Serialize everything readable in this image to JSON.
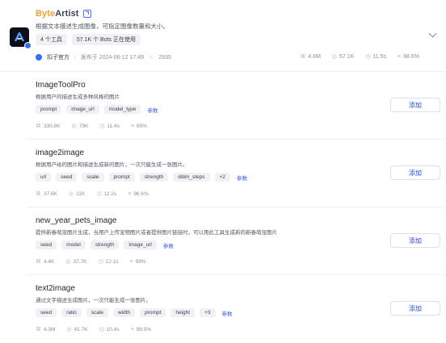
{
  "plugin": {
    "name_part1": "Byte",
    "name_part2": "Artist",
    "description": "根据文本描述生成图像，可指定图像数量和大小。",
    "tags": [
      "4 个工具",
      "57.1K 个 Bots 正在使用"
    ],
    "author": "扣子官方",
    "published": "发布于 2024-06-12 17:49",
    "favorites": "2935",
    "stats": [
      "4.6M",
      "57.1K",
      "11.5s",
      "98.6%"
    ],
    "logo_icon": "byteartist-logo-icon"
  },
  "tools": [
    {
      "name": "ImageToolPro",
      "description": "根据用户的描述生成多种风格的图片",
      "params": [
        "prompt",
        "image_url",
        "model_type"
      ],
      "more": "",
      "params_label": "参数",
      "stats": [
        "330.8K",
        "79K",
        "11.4s",
        "99%"
      ],
      "add_label": "添加"
    },
    {
      "name": "image2image",
      "description": "根据用户给的图片和描述生成新的图片，一次只能生成一张图片。",
      "params": [
        "url",
        "seed",
        "scale",
        "prompt",
        "strength",
        "ddim_steps"
      ],
      "more": "+2",
      "params_label": "参数",
      "stats": [
        "37.6K",
        "11K",
        "12.2s",
        "96.6%"
      ],
      "add_label": "添加"
    },
    {
      "name": "new_year_pets_image",
      "description": "提供新春萌宠图片生成，当用户上传宠物图片或者提供图片链接时，可以用此工具生成新的新春萌宠图片",
      "params": [
        "seed",
        "model",
        "strength",
        "image_url"
      ],
      "more": "",
      "params_label": "参数",
      "stats": [
        "4.4K",
        "37.7K",
        "12.1s",
        "99%"
      ],
      "add_label": "添加"
    },
    {
      "name": "text2image",
      "description": "通过文字描述生成图片，一次只能生成一张图片。",
      "params": [
        "seed",
        "ratio",
        "scale",
        "width",
        "prompt",
        "height"
      ],
      "more": "+3",
      "params_label": "参数",
      "stats": [
        "4.3M",
        "41.7K",
        "10.4s",
        "99.5%"
      ],
      "add_label": "添加"
    }
  ]
}
